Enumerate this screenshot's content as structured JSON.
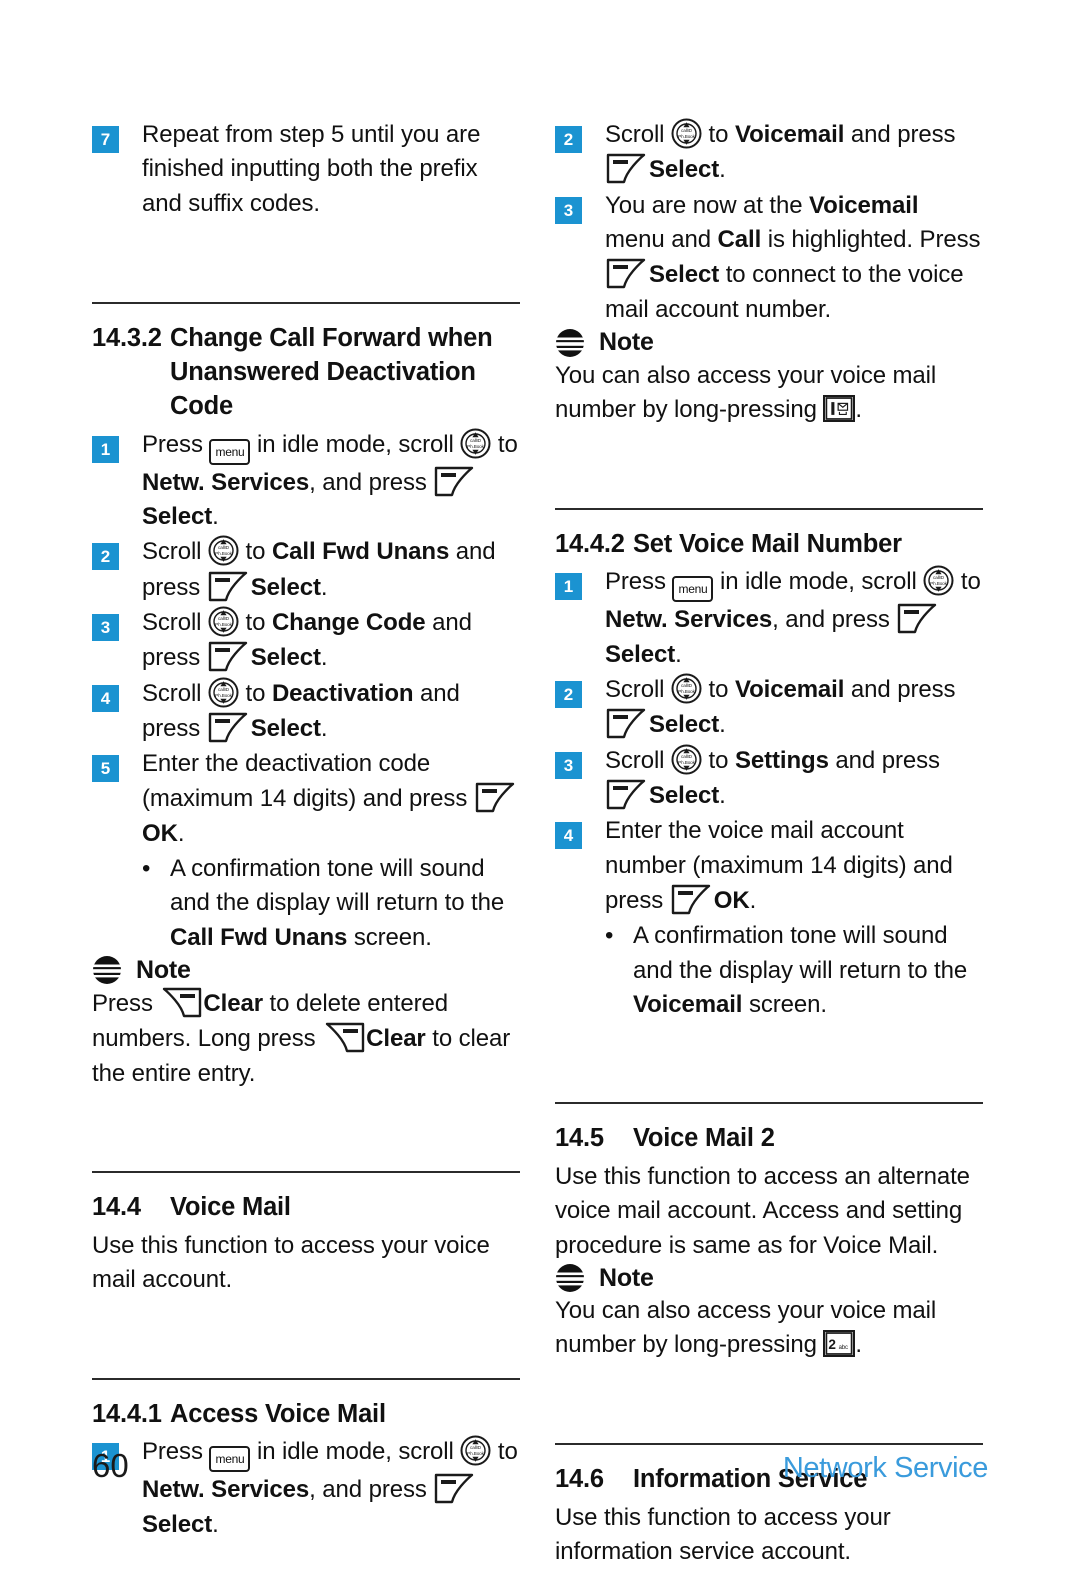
{
  "page": {
    "number": "60",
    "footer_title": "Network Service",
    "accent_blue": "#1b93d1",
    "footer_blue": "#3a9bdc"
  },
  "icons": {
    "menu_label": "menu",
    "nav_top_label": "callID",
    "nav_bottom_label": "Ph.Book",
    "key_one": "1",
    "key_two": "2",
    "key_two_sub": "abc"
  },
  "left_column": {
    "step7": {
      "num": "7",
      "text": "Repeat from step 5 until you are finished inputting both the prefix and suffix codes."
    },
    "section_14_3_2": {
      "number": "14.3.2",
      "title": "Change Call Forward when Unanswered Deactivation Code",
      "steps": [
        {
          "num": "1",
          "t1": "Press ",
          "t2": " in idle mode, scroll ",
          "t3": " to ",
          "b1": "Netw. Services",
          "t4": ", and press ",
          "b2": "Select",
          "t5": "."
        },
        {
          "num": "2",
          "t1": "Scroll ",
          "t2": " to ",
          "b1": "Call Fwd Unans",
          "t3": " and press ",
          "b2": "Select",
          "t4": "."
        },
        {
          "num": "3",
          "t1": "Scroll ",
          "t2": " to ",
          "b1": "Change Code",
          "t3": " and press ",
          "b2": "Select",
          "t4": "."
        },
        {
          "num": "4",
          "t1": "Scroll ",
          "t2": " to ",
          "b1": "Deactivation",
          "t3": " and press ",
          "b2": "Select",
          "t4": "."
        },
        {
          "num": "5",
          "t1": "Enter the deactivation code (maximum 14 digits) and press ",
          "b1": "OK",
          "t2": "."
        }
      ],
      "bullet": {
        "dot": "•",
        "t1": "A confirmation tone will sound and the display will return to the ",
        "b1": "Call Fwd Unans",
        "t2": " screen."
      },
      "note": {
        "title": "Note",
        "t1": "Press ",
        "b1": "Clear",
        "t2": " to delete entered numbers. Long press ",
        "b2": "Clear",
        "t3": " to clear the entire entry."
      }
    },
    "section_14_4": {
      "number": "14.4",
      "title": "Voice Mail",
      "body": "Use this function to access your voice mail account."
    },
    "section_14_4_1": {
      "number": "14.4.1",
      "title": "Access Voice Mail",
      "steps": [
        {
          "num": "1",
          "t1": "Press ",
          "t2": " in idle mode, scroll ",
          "t3": " to ",
          "b1": "Netw. Services",
          "t4": ", and press ",
          "b2": "Select",
          "t5": "."
        }
      ]
    }
  },
  "right_column": {
    "continued_steps": [
      {
        "num": "2",
        "t1": "Scroll ",
        "t2": " to ",
        "b1": "Voicemail",
        "t3": " and press ",
        "b2": "Select",
        "t4": "."
      },
      {
        "num": "3",
        "t1": "You are now at the ",
        "b1": "Voicemail",
        "t2": " menu and ",
        "b2": "Call",
        "t3": " is highlighted. Press ",
        "b3": "Select",
        "t4": " to connect to the voice mail account number."
      }
    ],
    "note_1": {
      "title": "Note",
      "t1": "You can also access your voice mail number by long-pressing ",
      "t2": "."
    },
    "section_14_4_2": {
      "number": "14.4.2",
      "title": "Set Voice Mail Number",
      "steps": [
        {
          "num": "1",
          "t1": "Press ",
          "t2": " in idle mode, scroll ",
          "t3": " to ",
          "b1": "Netw. Services",
          "t4": ", and press ",
          "b2": "Select",
          "t5": "."
        },
        {
          "num": "2",
          "t1": "Scroll ",
          "t2": " to ",
          "b1": "Voicemail",
          "t3": " and press ",
          "b2": "Select",
          "t4": "."
        },
        {
          "num": "3",
          "t1": "Scroll ",
          "t2": " to ",
          "b1": "Settings",
          "t3": " and press ",
          "b2": "Select",
          "t4": "."
        },
        {
          "num": "4",
          "t1": "Enter the voice mail account number (maximum 14 digits) and press ",
          "b1": "OK",
          "t2": "."
        }
      ],
      "bullet": {
        "dot": "•",
        "t1": "A confirmation tone will sound and the display will return to the ",
        "b1": "Voicemail",
        "t2": " screen."
      }
    },
    "section_14_5": {
      "number": "14.5",
      "title": "Voice Mail 2",
      "body": "Use this function to access an alternate voice mail account. Access and setting procedure is same as for Voice Mail.",
      "note": {
        "title": "Note",
        "t1": "You can also access your voice mail number by long-pressing ",
        "t2": "."
      }
    },
    "section_14_6": {
      "number": "14.6",
      "title": "Information Service",
      "body": "Use this function to access your information service account."
    }
  }
}
